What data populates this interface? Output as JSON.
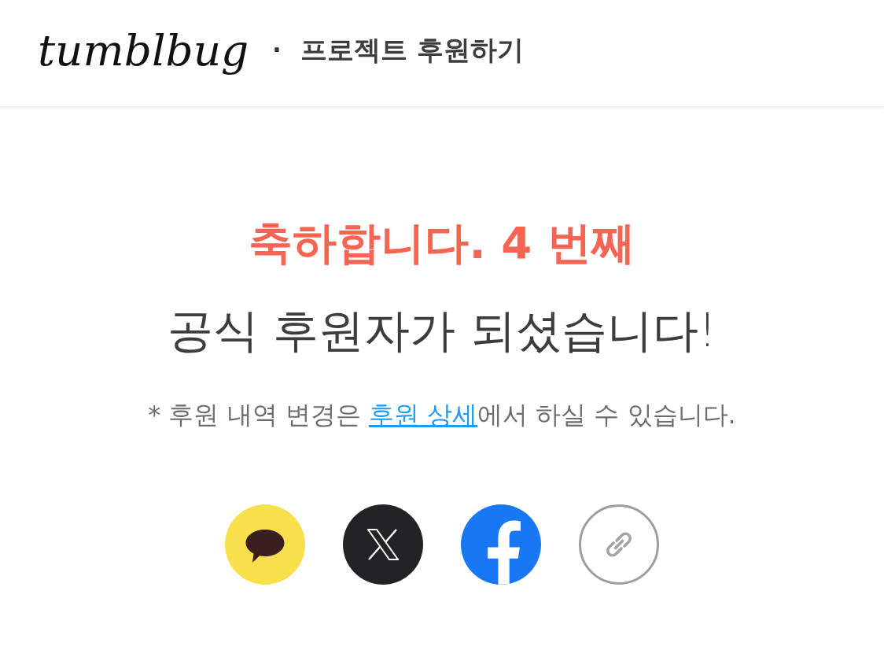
{
  "header": {
    "logo": "tumblbug",
    "separator": "·",
    "title": "프로젝트 후원하기"
  },
  "message": {
    "headline": "축하합니다. 4 번째",
    "subline": "공식 후원자가 되셨습니다!",
    "note": {
      "before": "* 후원 내역 변경은 ",
      "link": "후원 상세",
      "after": "에서 하실 수 있습니다."
    }
  },
  "share_buttons": [
    {
      "kind": "chat"
    },
    {
      "kind": "x"
    },
    {
      "kind": "facebook"
    },
    {
      "kind": "link"
    }
  ]
}
